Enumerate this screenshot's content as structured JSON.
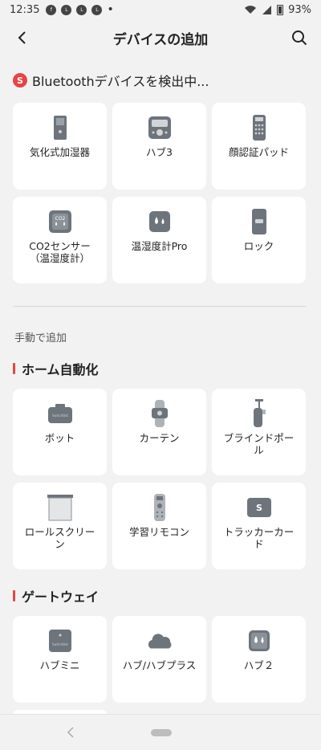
{
  "status_bar": {
    "time": "12:35",
    "notif_icons": [
      "facebook-icon",
      "line-icon",
      "line-icon",
      "line-icon"
    ],
    "more": "•",
    "battery": "93%"
  },
  "header": {
    "title": "デバイスの追加"
  },
  "scan": {
    "badge": "S",
    "text": "Bluetoothデバイスを検出中..."
  },
  "detected_devices": [
    {
      "label": "気化式加湿器",
      "icon": "humidifier-icon"
    },
    {
      "label": "ハブ3",
      "icon": "hub3-icon"
    },
    {
      "label": "顔認証パッド",
      "icon": "keypad-icon"
    },
    {
      "label": "CO2センサー\n（温湿度計）",
      "icon": "co2-sensor-icon"
    },
    {
      "label": "温湿度計Pro",
      "icon": "meter-pro-icon"
    },
    {
      "label": "ロック",
      "icon": "lock-icon"
    }
  ],
  "manual_label": "手動で追加",
  "sections": [
    {
      "title": "ホーム自動化",
      "items": [
        {
          "label": "ボット",
          "icon": "bot-icon"
        },
        {
          "label": "カーテン",
          "icon": "curtain-icon"
        },
        {
          "label": "ブラインドポー\nル",
          "icon": "blind-pole-icon"
        },
        {
          "label": "ロールスクリー\nン",
          "icon": "roller-shade-icon"
        },
        {
          "label": "学習リモコン",
          "icon": "remote-icon"
        },
        {
          "label": "トラッカーカー\nド",
          "icon": "tracker-card-icon"
        }
      ]
    },
    {
      "title": "ゲートウェイ",
      "items": [
        {
          "label": "ハブミニ",
          "icon": "hub-mini-icon"
        },
        {
          "label": "ハブ/ハブプラス",
          "icon": "hub-plus-icon"
        },
        {
          "label": "ハブ２",
          "icon": "hub2-icon"
        }
      ]
    }
  ],
  "colors": {
    "accent": "#e64545",
    "background": "#f2f2f2",
    "card": "#ffffff",
    "icon": "#7d8590"
  }
}
